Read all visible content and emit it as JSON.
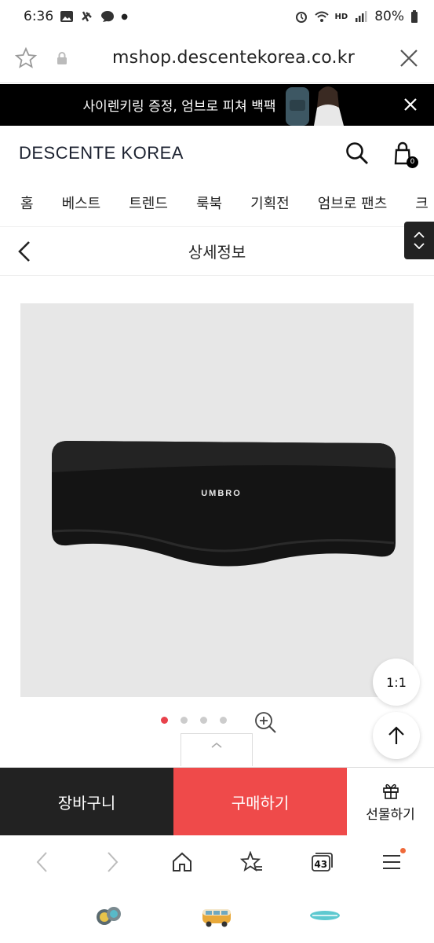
{
  "status_bar": {
    "time": "6:36",
    "battery": "80%",
    "hd_label": "HD"
  },
  "browser": {
    "url": "mshop.descentekorea.co.kr",
    "tab_count": "43"
  },
  "promo": {
    "text": "사이렌키링 증정, 엄브로 피쳐 백팩"
  },
  "site": {
    "logo": "DESCENTE KOREA",
    "cart_count": "0"
  },
  "gnb": {
    "items": [
      "홈",
      "베스트",
      "트렌드",
      "룩북",
      "기획전",
      "엄브로 팬츠",
      "크"
    ]
  },
  "subheader": {
    "title": "상세정보"
  },
  "product": {
    "brand_mark": "UMBRO",
    "ratio_label": "1:1",
    "image_count": 4,
    "active_image": 1
  },
  "buy_bar": {
    "cart_label": "장바구니",
    "buy_label": "구매하기",
    "gift_label": "선물하기"
  },
  "colors": {
    "buy": "#ef4a4a",
    "cart": "#222222",
    "active_dot": "#e8414b"
  }
}
